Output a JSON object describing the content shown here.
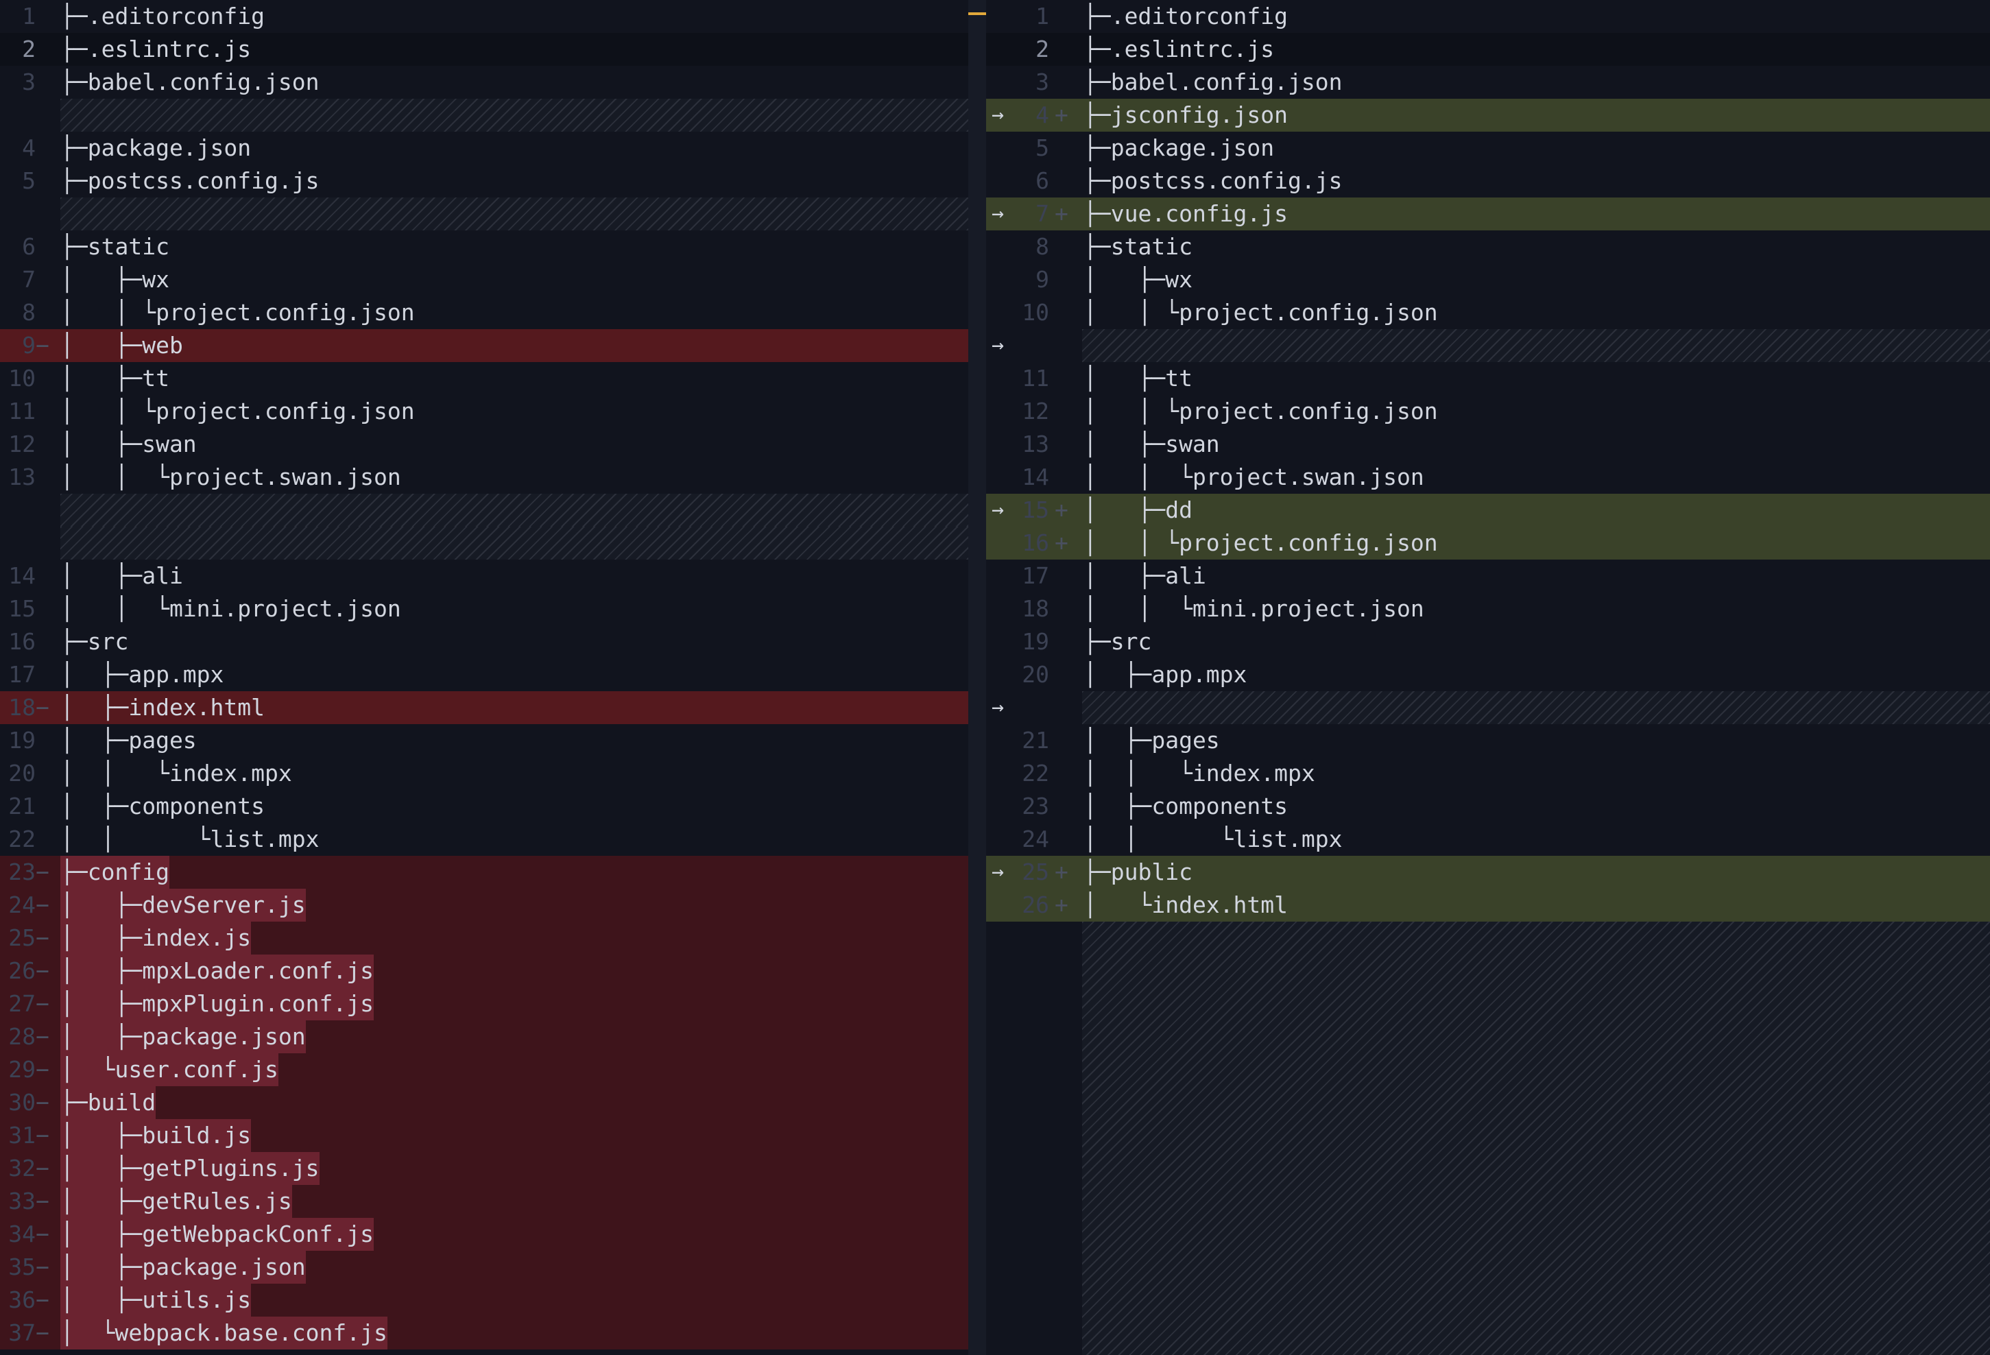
{
  "left": {
    "rows": [
      {
        "kind": "ctx",
        "ln": "1",
        "code": "├─.editorconfig"
      },
      {
        "kind": "ctx",
        "ln": "2",
        "code": "├─.eslintrc.js",
        "cur": true
      },
      {
        "kind": "ctx",
        "ln": "3",
        "code": "├─babel.config.json"
      },
      {
        "kind": "filler"
      },
      {
        "kind": "ctx",
        "ln": "4",
        "code": "├─package.json"
      },
      {
        "kind": "ctx",
        "ln": "5",
        "code": "├─postcss.config.js"
      },
      {
        "kind": "filler"
      },
      {
        "kind": "ctx",
        "ln": "6",
        "code": "├─static"
      },
      {
        "kind": "ctx",
        "ln": "7",
        "code": "│   ├─wx"
      },
      {
        "kind": "ctx",
        "ln": "8",
        "code": "│   │ └project.config.json"
      },
      {
        "kind": "removed",
        "ln": "9",
        "marker": "−",
        "code": "│   ├─web"
      },
      {
        "kind": "ctx",
        "ln": "10",
        "code": "│   ├─tt"
      },
      {
        "kind": "ctx",
        "ln": "11",
        "code": "│   │ └project.config.json"
      },
      {
        "kind": "ctx",
        "ln": "12",
        "code": "│   ├─swan"
      },
      {
        "kind": "ctx",
        "ln": "13",
        "code": "│   │  └project.swan.json"
      },
      {
        "kind": "filler"
      },
      {
        "kind": "filler"
      },
      {
        "kind": "ctx",
        "ln": "14",
        "code": "│   ├─ali"
      },
      {
        "kind": "ctx",
        "ln": "15",
        "code": "│   │  └mini.project.json"
      },
      {
        "kind": "ctx",
        "ln": "16",
        "code": "├─src"
      },
      {
        "kind": "ctx",
        "ln": "17",
        "code": "│  ├─app.mpx"
      },
      {
        "kind": "removed",
        "ln": "18",
        "marker": "−",
        "code": "│  ├─index.html"
      },
      {
        "kind": "ctx",
        "ln": "19",
        "code": "│  ├─pages"
      },
      {
        "kind": "ctx",
        "ln": "20",
        "code": "│  │   └index.mpx"
      },
      {
        "kind": "ctx",
        "ln": "21",
        "code": "│  ├─components"
      },
      {
        "kind": "ctx",
        "ln": "22",
        "code": "│  │      └list.mpx"
      },
      {
        "kind": "removed-block",
        "ln": "23",
        "marker": "−",
        "code": "├─config"
      },
      {
        "kind": "removed-block",
        "ln": "24",
        "marker": "−",
        "code": "│   ├─devServer.js"
      },
      {
        "kind": "removed-block",
        "ln": "25",
        "marker": "−",
        "code": "│   ├─index.js"
      },
      {
        "kind": "removed-block",
        "ln": "26",
        "marker": "−",
        "code": "│   ├─mpxLoader.conf.js"
      },
      {
        "kind": "removed-block",
        "ln": "27",
        "marker": "−",
        "code": "│   ├─mpxPlugin.conf.js"
      },
      {
        "kind": "removed-block",
        "ln": "28",
        "marker": "−",
        "code": "│   ├─package.json"
      },
      {
        "kind": "removed-block",
        "ln": "29",
        "marker": "−",
        "code": "│  └user.conf.js"
      },
      {
        "kind": "removed-block",
        "ln": "30",
        "marker": "−",
        "code": "├─build"
      },
      {
        "kind": "removed-block",
        "ln": "31",
        "marker": "−",
        "code": "│   ├─build.js"
      },
      {
        "kind": "removed-block",
        "ln": "32",
        "marker": "−",
        "code": "│   ├─getPlugins.js"
      },
      {
        "kind": "removed-block",
        "ln": "33",
        "marker": "−",
        "code": "│   ├─getRules.js"
      },
      {
        "kind": "removed-block",
        "ln": "34",
        "marker": "−",
        "code": "│   ├─getWebpackConf.js"
      },
      {
        "kind": "removed-block",
        "ln": "35",
        "marker": "−",
        "code": "│   ├─package.json"
      },
      {
        "kind": "removed-block",
        "ln": "36",
        "marker": "−",
        "code": "│   ├─utils.js"
      },
      {
        "kind": "removed-block",
        "ln": "37",
        "marker": "−",
        "code": "│  └webpack.base.conf.js"
      }
    ]
  },
  "right": {
    "rows": [
      {
        "kind": "ctx",
        "ln": "1",
        "code": "├─.editorconfig"
      },
      {
        "kind": "ctx",
        "ln": "2",
        "code": "├─.eslintrc.js",
        "cur": true
      },
      {
        "kind": "ctx",
        "ln": "3",
        "code": "├─babel.config.json"
      },
      {
        "kind": "added",
        "ln": "4",
        "marker": "+",
        "code": "├─jsconfig.json",
        "arrow": "→"
      },
      {
        "kind": "ctx",
        "ln": "5",
        "code": "├─package.json"
      },
      {
        "kind": "ctx",
        "ln": "6",
        "code": "├─postcss.config.js"
      },
      {
        "kind": "added",
        "ln": "7",
        "marker": "+",
        "code": "├─vue.config.js",
        "arrow": "→"
      },
      {
        "kind": "ctx",
        "ln": "8",
        "code": "├─static"
      },
      {
        "kind": "ctx",
        "ln": "9",
        "code": "│   ├─wx"
      },
      {
        "kind": "ctx",
        "ln": "10",
        "code": "│   │ └project.config.json"
      },
      {
        "kind": "filler",
        "arrow": "→"
      },
      {
        "kind": "ctx",
        "ln": "11",
        "code": "│   ├─tt"
      },
      {
        "kind": "ctx",
        "ln": "12",
        "code": "│   │ └project.config.json"
      },
      {
        "kind": "ctx",
        "ln": "13",
        "code": "│   ├─swan"
      },
      {
        "kind": "ctx",
        "ln": "14",
        "code": "│   │  └project.swan.json"
      },
      {
        "kind": "added",
        "ln": "15",
        "marker": "+",
        "code": "│   ├─dd",
        "arrow": "→"
      },
      {
        "kind": "added",
        "ln": "16",
        "marker": "+",
        "code": "│   │ └project.config.json"
      },
      {
        "kind": "ctx",
        "ln": "17",
        "code": "│   ├─ali"
      },
      {
        "kind": "ctx",
        "ln": "18",
        "code": "│   │  └mini.project.json"
      },
      {
        "kind": "ctx",
        "ln": "19",
        "code": "├─src"
      },
      {
        "kind": "ctx",
        "ln": "20",
        "code": "│  ├─app.mpx"
      },
      {
        "kind": "filler",
        "arrow": "→"
      },
      {
        "kind": "ctx",
        "ln": "21",
        "code": "│  ├─pages"
      },
      {
        "kind": "ctx",
        "ln": "22",
        "code": "│  │   └index.mpx"
      },
      {
        "kind": "ctx",
        "ln": "23",
        "code": "│  ├─components"
      },
      {
        "kind": "ctx",
        "ln": "24",
        "code": "│  │      └list.mpx"
      },
      {
        "kind": "added",
        "ln": "25",
        "marker": "+",
        "code": "├─public",
        "arrow": "→"
      },
      {
        "kind": "added",
        "ln": "26",
        "marker": "+",
        "code": "│   └index.html"
      }
    ]
  },
  "colors": {
    "background": "#11141e",
    "removed_line": "#55191e",
    "removed_block": "#3e141b",
    "added_line": "#3a4229",
    "scroll_marker": "#e2a93b"
  }
}
